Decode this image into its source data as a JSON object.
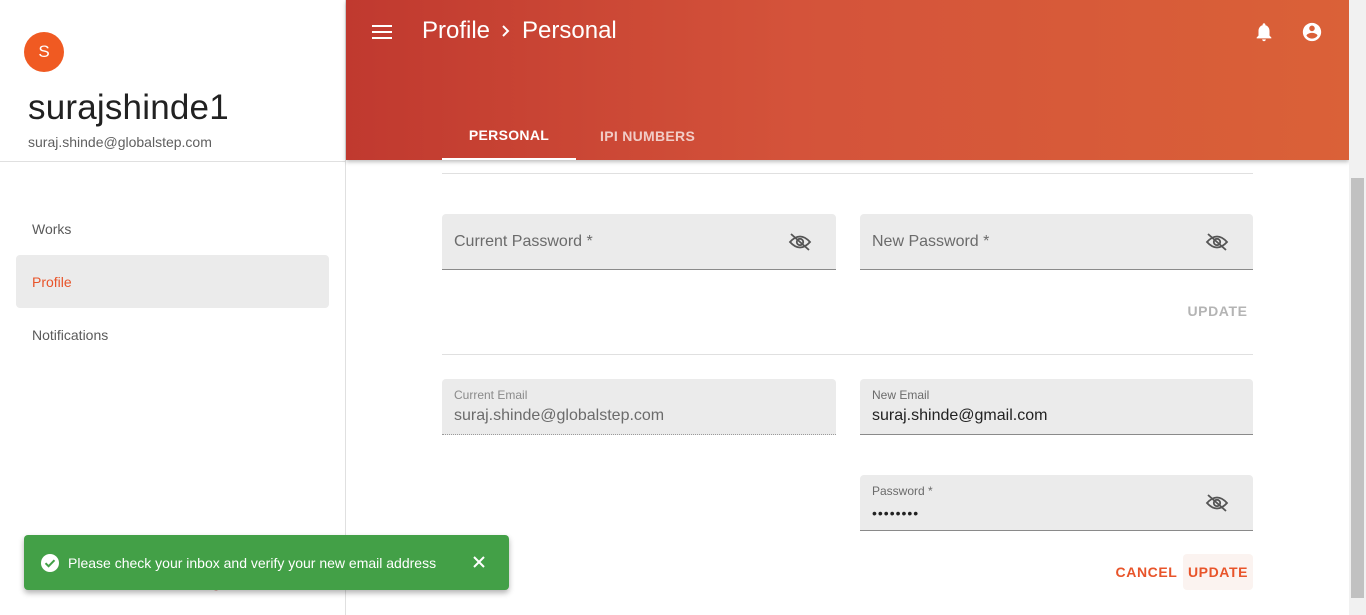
{
  "user": {
    "initial": "S",
    "name": "surajshinde1",
    "email": "suraj.shinde@globalstep.com"
  },
  "sidebar": {
    "items": [
      {
        "label": "Works",
        "active": false
      },
      {
        "label": "Profile",
        "active": true
      },
      {
        "label": "Notifications",
        "active": false
      }
    ]
  },
  "header": {
    "breadcrumb": [
      "Profile",
      "Personal"
    ],
    "tabs": [
      {
        "label": "PERSONAL",
        "active": true
      },
      {
        "label": "IPI NUMBERS",
        "active": false
      }
    ]
  },
  "password_section": {
    "current_password_placeholder": "Current Password *",
    "new_password_placeholder": "New Password *",
    "update_label": "UPDATE"
  },
  "email_section": {
    "current_email_label": "Current Email",
    "current_email_value": "suraj.shinde@globalstep.com",
    "new_email_label": "New Email",
    "new_email_value": "suraj.shinde@gmail.com",
    "password_label": "Password *",
    "password_value": "••••••••",
    "cancel_label": "CANCEL",
    "update_label": "UPDATE"
  },
  "snackbar": {
    "message": "Please check your inbox and verify your new email address"
  },
  "colors": {
    "accent": "#e8542a",
    "header_start": "#c0392f",
    "header_end": "#da6138",
    "success": "#43a047"
  },
  "icons": [
    "menu-icon",
    "chevron-right-icon",
    "bell-icon",
    "account-icon",
    "eye-off-icon",
    "check-circle-icon",
    "close-icon"
  ]
}
